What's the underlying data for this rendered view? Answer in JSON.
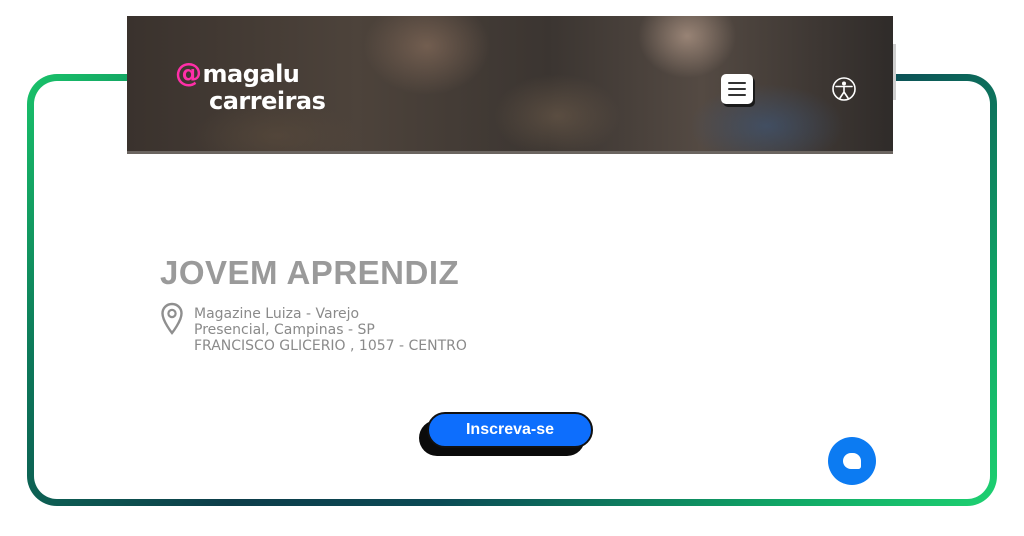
{
  "header": {
    "logo_line1": "magalu",
    "logo_at": "@",
    "logo_line2": "carreiras",
    "menu_icon": "hamburger-menu-icon",
    "accessibility_icon": "accessibility-icon"
  },
  "job": {
    "title": "JOVEM APRENDIZ",
    "company": "Magazine Luiza - Varejo",
    "mode_location": "Presencial, Campinas - SP",
    "address": "FRANCISCO GLICERIO , 1057 - CENTRO",
    "location_icon": "map-pin-icon"
  },
  "actions": {
    "apply_label": "Inscreva-se"
  },
  "chat": {
    "icon": "chat-bubble-icon"
  },
  "colors": {
    "brand_pink": "#ff2fa8",
    "primary_blue": "#0d6efd",
    "frame_green": "#19c36a",
    "frame_dark": "#0d3d4a"
  }
}
